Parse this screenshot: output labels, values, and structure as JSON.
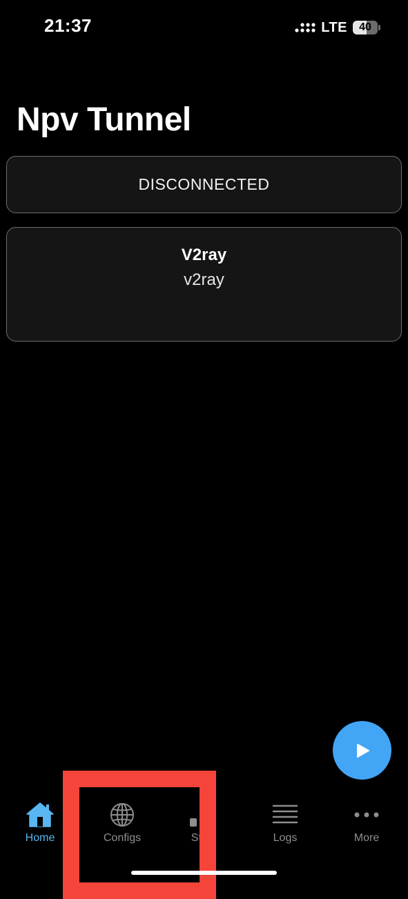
{
  "status_bar": {
    "time": "21:37",
    "network": "LTE",
    "battery": "40"
  },
  "page": {
    "title": "Npv Tunnel"
  },
  "connection": {
    "status": "DISCONNECTED"
  },
  "config": {
    "name": "V2ray",
    "type": "v2ray"
  },
  "tabs": [
    {
      "label": "Home",
      "icon": "home-icon",
      "active": true
    },
    {
      "label": "Configs",
      "icon": "globe-icon",
      "active": false
    },
    {
      "label": "Stats",
      "icon": "bar-chart-icon",
      "active": false
    },
    {
      "label": "Logs",
      "icon": "list-icon",
      "active": false
    },
    {
      "label": "More",
      "icon": "more-dots-icon",
      "active": false
    }
  ],
  "colors": {
    "accent": "#42a5f5",
    "active_tab": "#5ab6f2",
    "inactive_tab": "#8e8e8e",
    "highlight": "#f5443a",
    "background": "#000000"
  }
}
